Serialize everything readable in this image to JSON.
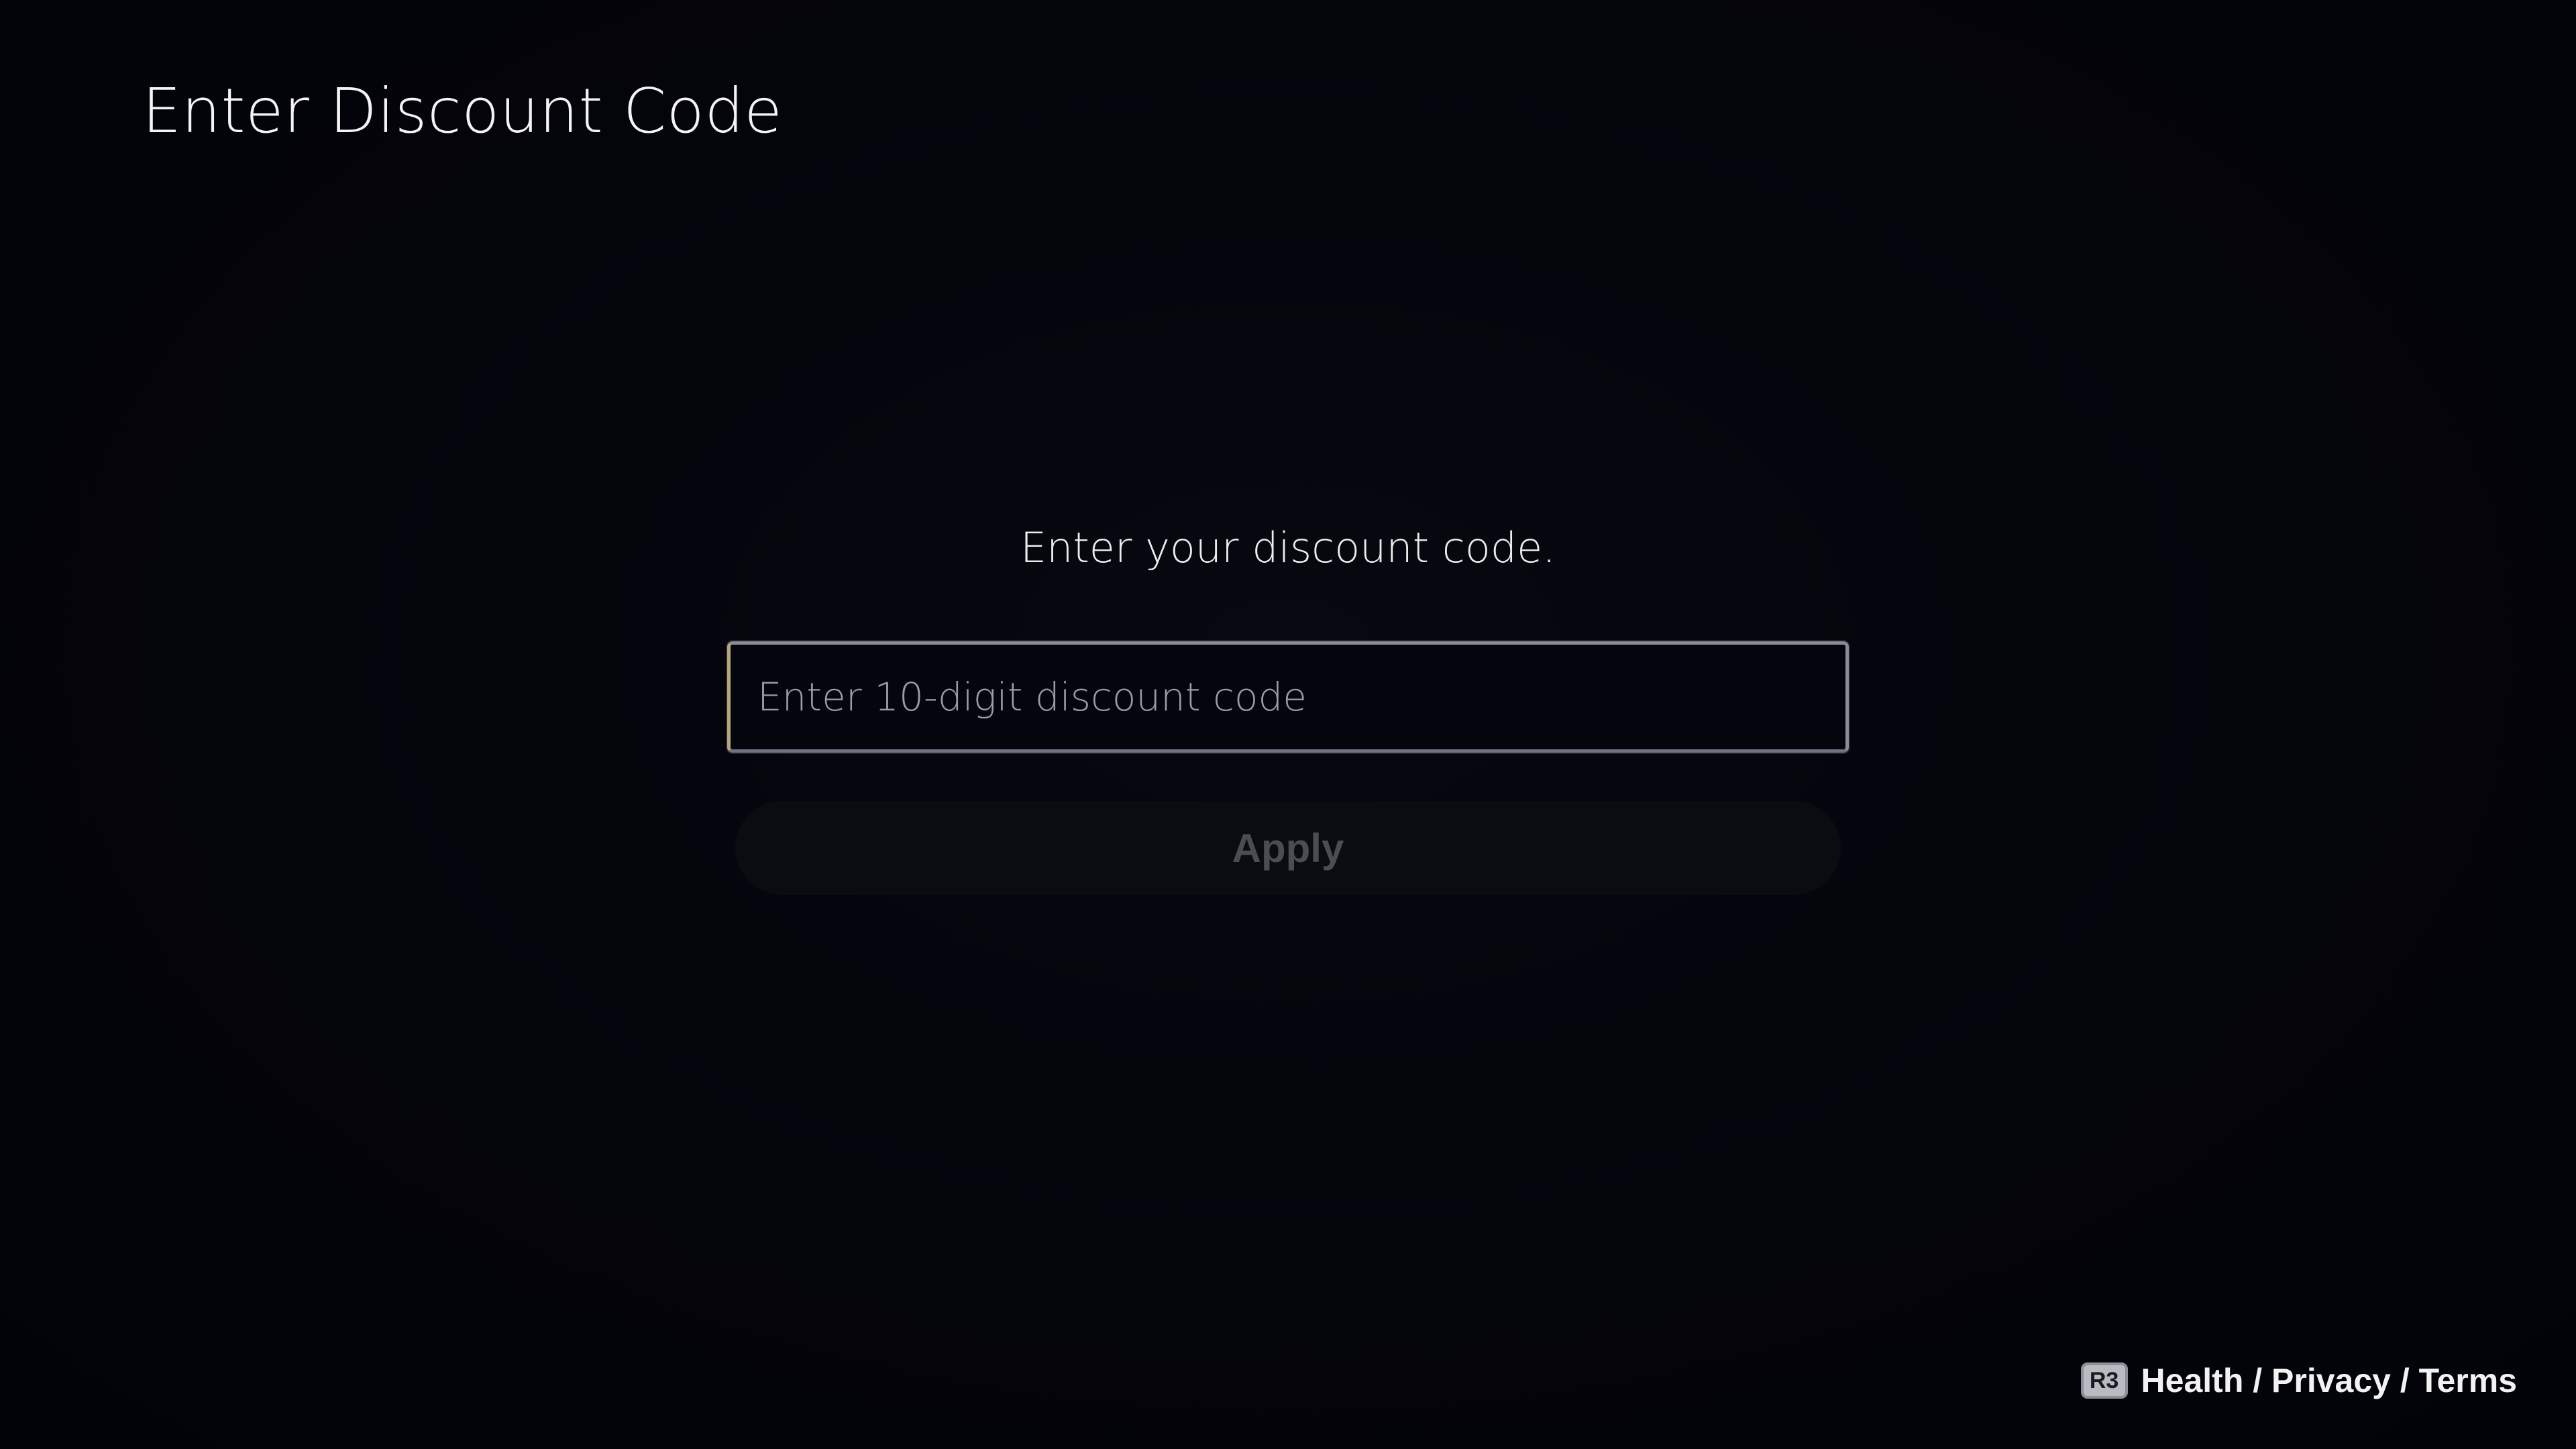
{
  "header": {
    "title": "Enter Discount Code"
  },
  "main": {
    "prompt": "Enter your discount code.",
    "code_input": {
      "value": "",
      "placeholder": "Enter 10-digit discount code"
    },
    "apply_label": "Apply"
  },
  "footer": {
    "button_glyph": "R3",
    "button_icon": "r3-button-icon",
    "link_label": "Health / Privacy / Terms"
  },
  "colors": {
    "background": "#03040a",
    "text": "#f2f2f2",
    "field_border": "#8a8c96",
    "field_focus_accent": "#b8a67a",
    "apply_disabled_text": "#4b4d55"
  }
}
